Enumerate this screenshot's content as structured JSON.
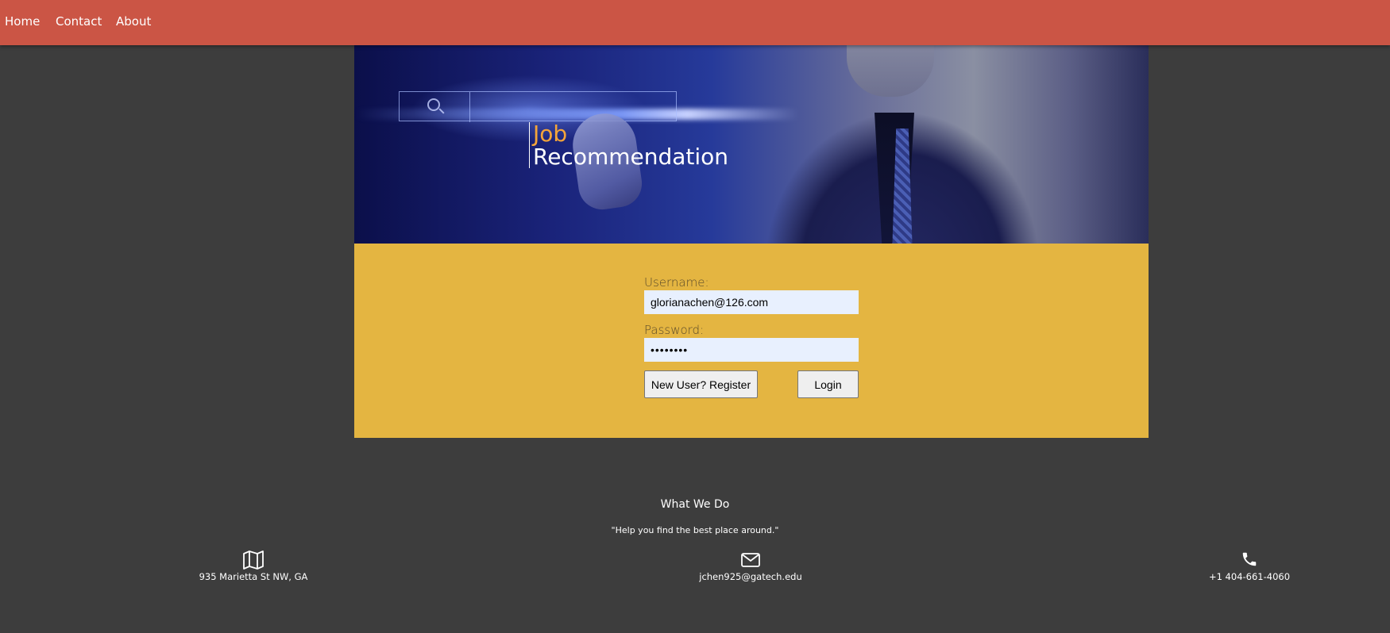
{
  "nav": {
    "items": [
      "Home",
      "Contact",
      "About"
    ]
  },
  "hero": {
    "title_word1": "Job",
    "title_word2": "Recommendation",
    "accent_color": "#f5a53a"
  },
  "login": {
    "username_label": "Username:",
    "username_value": "glorianachen@126.com",
    "password_label": "Password:",
    "password_value": "••••••••",
    "register_button": "New User? Register",
    "login_button": "Login",
    "panel_color": "#e4b541"
  },
  "footer": {
    "title": "What We Do",
    "quote": "\"Help you find the best place around.\"",
    "address": "935 Marietta St NW, GA",
    "email": "jchen925@gatech.edu",
    "phone": "+1 404-661-4060",
    "icons": [
      "map-icon",
      "envelope-icon",
      "phone-icon"
    ]
  },
  "colors": {
    "nav_bg": "#cb5545",
    "page_bg": "#3d3d3d"
  }
}
